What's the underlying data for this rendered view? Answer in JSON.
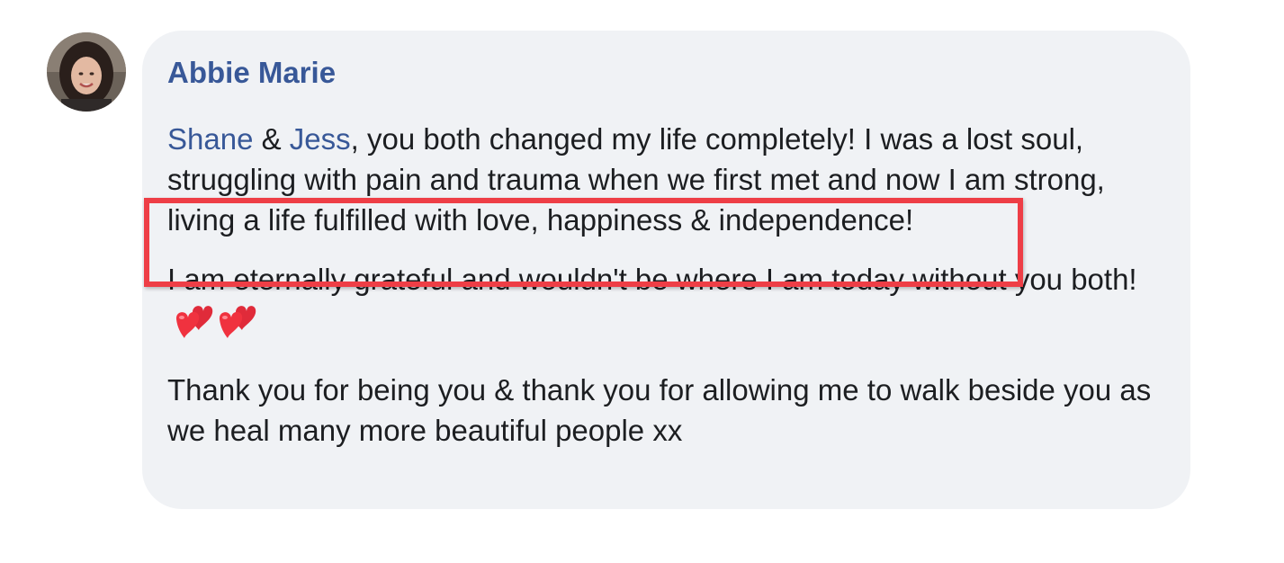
{
  "comment": {
    "author": "Abbie Marie",
    "mention_1": "Shane",
    "connector": " & ",
    "mention_2": "Jess",
    "paragraph_1_rest": ", you both changed my life completely! I was a lost soul, struggling with pain and trauma when we first met and now I am strong, living a life fulfilled with love, happiness & independence!",
    "paragraph_2": "I am eternally grateful and wouldn't be where I am today without you both! ",
    "paragraph_2_emoji": "two-hearts-icon x2",
    "paragraph_3": "Thank you for being you & thank you for allowing me to walk beside you as we heal many more beautiful people xx"
  },
  "colors": {
    "author": "#385898",
    "mention": "#385898",
    "text": "#1c1e21",
    "bubble": "#f0f2f5",
    "highlight": "#ee3e46"
  }
}
